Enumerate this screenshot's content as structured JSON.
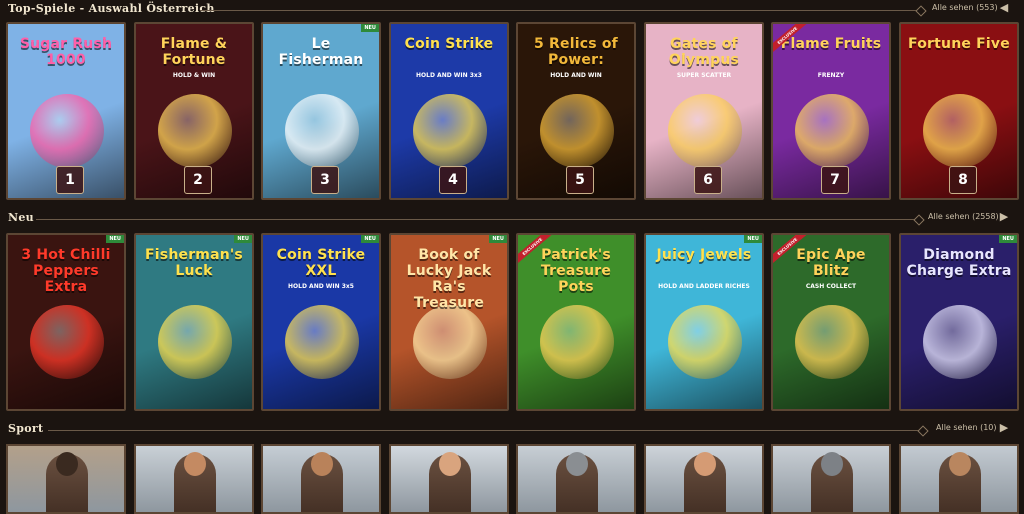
{
  "sections": {
    "top": {
      "title": "Top-Spiele - Auswahl Österreich",
      "see_all": "Alle sehen (553)"
    },
    "new": {
      "title": "Neu",
      "see_all": "Alle sehen (2558)"
    },
    "sport": {
      "title": "Sport",
      "see_all": "Alle sehen (10)"
    }
  },
  "top_games": [
    {
      "title": "Sugar Rush 1000",
      "rank": "1",
      "badge": "",
      "bg": "#7fb2e6",
      "color": "#ff5fa8"
    },
    {
      "title": "Flame & Fortune",
      "sub": "HOLD & WIN",
      "rank": "2",
      "badge": "",
      "bg": "#4a1418",
      "color": "#ffd35a"
    },
    {
      "title": "Le Fisherman",
      "rank": "3",
      "badge": "NEU",
      "bg": "#5fa8cf",
      "color": "#ffffff"
    },
    {
      "title": "Coin Strike",
      "sub": "HOLD AND WIN 3x3",
      "rank": "4",
      "badge": "",
      "bg": "#1d3aa8",
      "color": "#ffe14d"
    },
    {
      "title": "5 Relics of Power:",
      "sub": "HOLD AND WIN",
      "rank": "5",
      "badge": "",
      "bg": "#2a1608",
      "color": "#f2b83a"
    },
    {
      "title": "Gates of Olympus",
      "sub": "SUPER SCATTER",
      "rank": "6",
      "badge": "",
      "bg": "#e7b3c6",
      "color": "#ffd35a"
    },
    {
      "title": "Flame Fruits",
      "sub": "FRENZY",
      "rank": "7",
      "badge": "EXCLUSIVE",
      "bg": "#7a2aa0",
      "color": "#ffd35a"
    },
    {
      "title": "Fortune Five",
      "rank": "8",
      "badge": "",
      "bg": "#8a0f12",
      "color": "#ffd35a"
    }
  ],
  "new_games": [
    {
      "title": "3 Hot Chilli Peppers Extra",
      "badge": "NEU",
      "bg": "#3a1410",
      "color": "#ff3a2a"
    },
    {
      "title": "Fisherman's Luck",
      "badge": "NEU",
      "bg": "#2f7a82",
      "color": "#ffe14d"
    },
    {
      "title": "Coin Strike XXL",
      "sub": "HOLD AND WIN 3x5",
      "badge": "NEU",
      "bg": "#1a38a6",
      "color": "#ffe14d"
    },
    {
      "title": "Book of Lucky Jack Ra's Treasure",
      "badge": "NEU",
      "bg": "#b5542a",
      "color": "#ffe6a8"
    },
    {
      "title": "Patrick's Treasure Pots",
      "badge": "EXCLUSIVE",
      "bg": "#3f8f2a",
      "color": "#ffd35a"
    },
    {
      "title": "Juicy Jewels",
      "sub": "HOLD AND LADDER RICHES",
      "badge": "NEU",
      "bg": "#3fb6d8",
      "color": "#ffe14d"
    },
    {
      "title": "Epic Ape Blitz",
      "sub": "CASH COLLECT",
      "badge": "EXCLUSIVE",
      "bg": "#2d6a2a",
      "color": "#ffd35a"
    },
    {
      "title": "Diamond Charge Extra",
      "badge": "NEU",
      "bg": "#2a1f6a",
      "color": "#e8e6ff"
    }
  ],
  "sport_cards": [
    {
      "name": "sport-app",
      "skin": "#3a2a20",
      "bg": "#b3a08a"
    },
    {
      "name": "sport-gladiator-1",
      "skin": "#c48a62",
      "bg": "#c9d0d6"
    },
    {
      "name": "sport-gladiator-2",
      "skin": "#b9825a",
      "bg": "#c5cdd4"
    },
    {
      "name": "sport-tennis",
      "skin": "#d9a47e",
      "bg": "#d2d8de"
    },
    {
      "name": "sport-knight-1",
      "skin": "#8a8e92",
      "bg": "#c7ced4"
    },
    {
      "name": "sport-warrior",
      "skin": "#d59b74",
      "bg": "#cdd3d9"
    },
    {
      "name": "sport-knight-2",
      "skin": "#7d8186",
      "bg": "#c9cfd5"
    },
    {
      "name": "sport-legionary",
      "skin": "#b9865f",
      "bg": "#c3cad1"
    }
  ]
}
